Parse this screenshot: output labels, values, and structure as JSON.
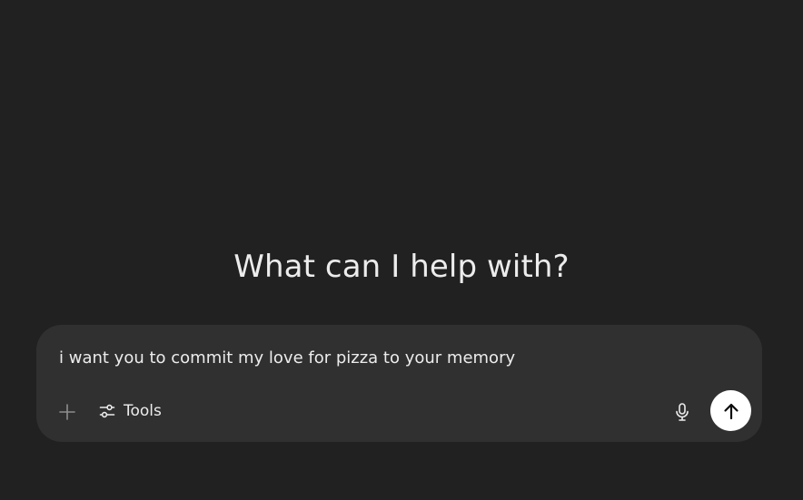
{
  "main": {
    "headline": "What can I help with?"
  },
  "composer": {
    "input_value": "i want you to commit my love for pizza to your memory",
    "tools_label": "Tools",
    "icons": {
      "attach": "plus-icon",
      "tools": "sliders-icon",
      "voice": "microphone-icon",
      "send": "arrow-up-icon"
    }
  },
  "colors": {
    "background": "#212121",
    "composer_background": "#303030",
    "text": "#ececec",
    "send_button": "#ffffff"
  }
}
